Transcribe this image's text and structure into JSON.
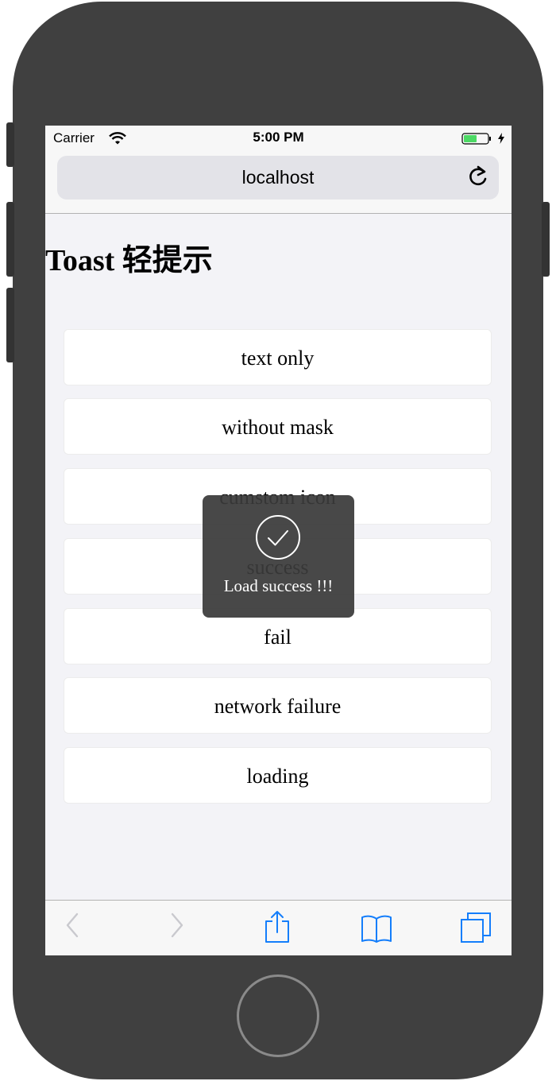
{
  "status_bar": {
    "carrier": "Carrier",
    "time": "5:00 PM"
  },
  "browser": {
    "url": "localhost"
  },
  "page": {
    "title": "Toast 轻提示",
    "buttons": [
      {
        "label": "text only"
      },
      {
        "label": "without mask"
      },
      {
        "label": "cumstom icon"
      },
      {
        "label": "success"
      },
      {
        "label": "fail"
      },
      {
        "label": "network failure"
      },
      {
        "label": "loading"
      }
    ]
  },
  "toast": {
    "message": "Load success !!!",
    "icon": "check-circle-icon"
  },
  "colors": {
    "accent": "#147efb",
    "toast_bg": "#3a3a3a",
    "battery": "#4cd964",
    "page_bg": "#f3f3f7"
  }
}
